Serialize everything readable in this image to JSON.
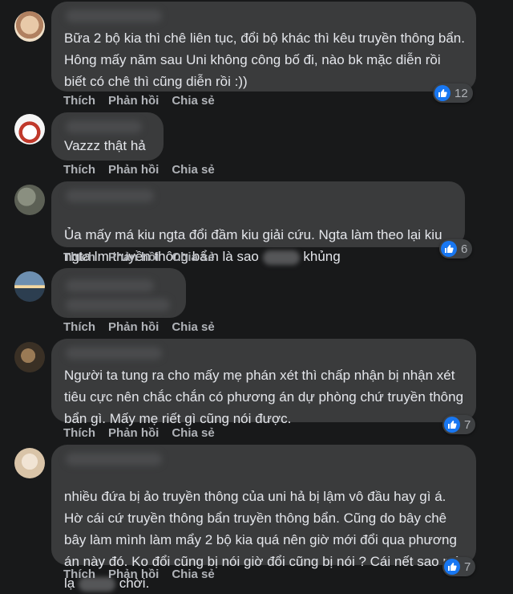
{
  "actions": {
    "like": "Thích",
    "reply": "Phản hồi",
    "share": "Chia sẻ"
  },
  "comments": [
    {
      "text": "Bữa 2 bộ kia thì chê liên tục, đổi bộ khác thì kêu truyền thông bẩn. Hông mấy năm sau Uni không công bố đi, nào bk mặc diễn rồi biết có chê thì cũng diễn rồi :))",
      "reactions": "12"
    },
    {
      "text": "Vazzz thật hả",
      "reactions": ""
    },
    {
      "text_a": "Ủa mấy má kiu ngta đổi đầm kiu giải cứu. Ngta làm theo lại kiu ngta lm truyền thông bẩ.n là sao",
      "text_b": "khủng",
      "reactions": "6"
    },
    {
      "text": "",
      "reactions": ""
    },
    {
      "text": "Người ta tung ra cho mấy mẹ phán xét thì chấp nhận bị nhận xét tiêu cực nên chắc chắn có phương án dự phòng chứ truyền thông bẩn gì. Mấy mẹ riết gì cũng nói được.",
      "reactions": "7"
    },
    {
      "text_a": "nhiều đứa bị ảo truyền thông của uni hả bị lậm vô đầu hay gì á. Hờ cái cứ truyền thông bẩn truyền thông bẩn. Cũng do bây chê bây làm mình làm mẩy 2 bộ kia quá nên giờ mới đổi qua phương án này đó. Ko đổi cũng bị nói giờ đổi cũng bị nói ? Cái nết sao mà lạ",
      "text_b": "chời.",
      "reactions": "7"
    }
  ],
  "colors": {
    "background": "#18191a",
    "bubble": "#3a3b3c",
    "like_blue": "#1877f2",
    "muted": "#b0b3b8"
  }
}
